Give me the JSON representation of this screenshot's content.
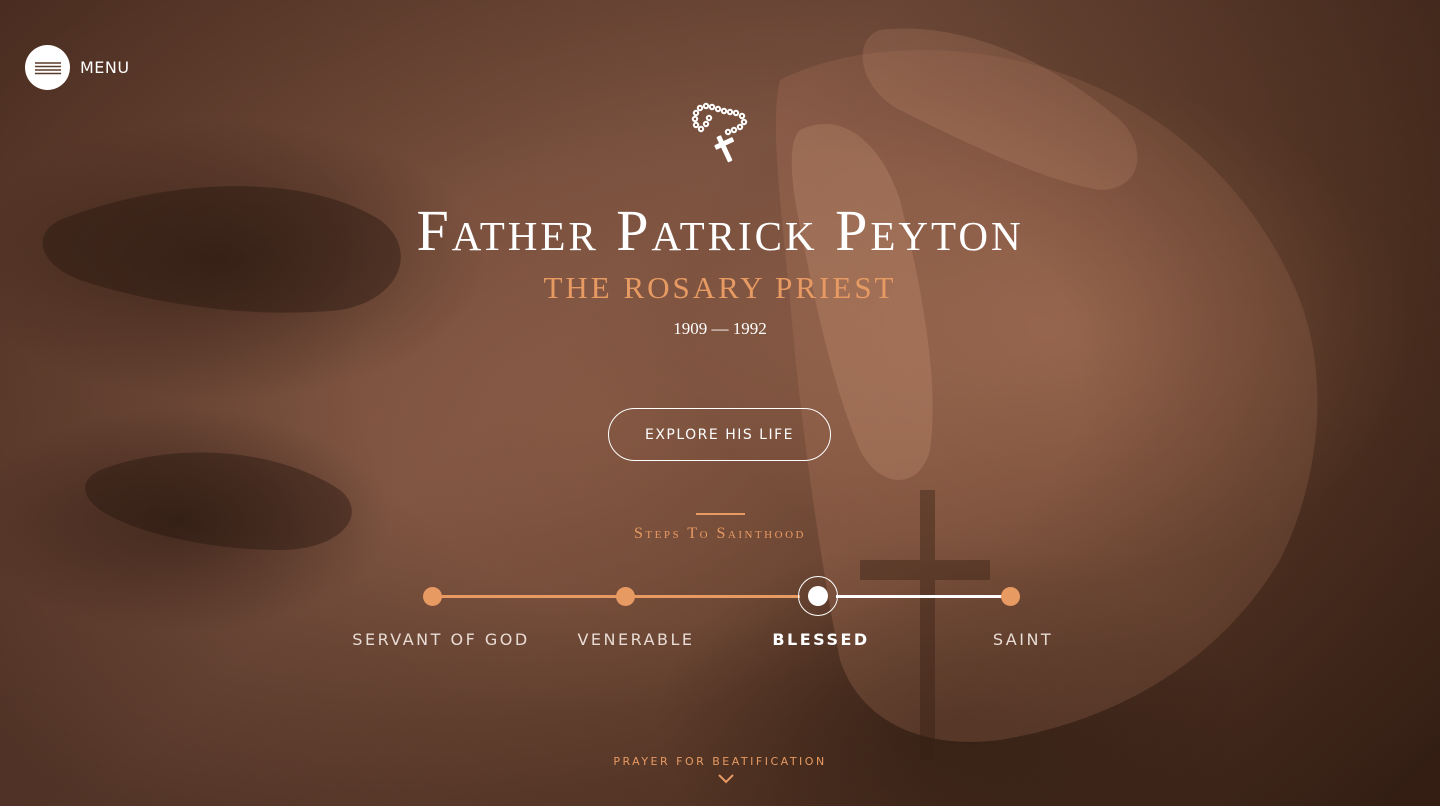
{
  "menu": {
    "label": "MENU",
    "icon": "hamburger-icon"
  },
  "hero": {
    "icon": "rosary-icon",
    "title": "Father Patrick Peyton",
    "subtitle": "THE ROSARY PRIEST",
    "years": "1909 — 1992",
    "cta_label": "EXPLORE HIS LIFE"
  },
  "steps": {
    "heading": "Steps To Sainthood",
    "items": [
      {
        "label": "SERVANT OF GOD",
        "state": "completed"
      },
      {
        "label": "VENERABLE",
        "state": "completed"
      },
      {
        "label": "BLESSED",
        "state": "current"
      },
      {
        "label": "SAINT",
        "state": "upcoming"
      }
    ]
  },
  "footer": {
    "prayer_label": "PRAYER FOR BEATIFICATION",
    "icon": "chevron-down-icon"
  },
  "colors": {
    "accent": "#e89a63",
    "text": "#ffffff",
    "background": "#5a3a28"
  }
}
